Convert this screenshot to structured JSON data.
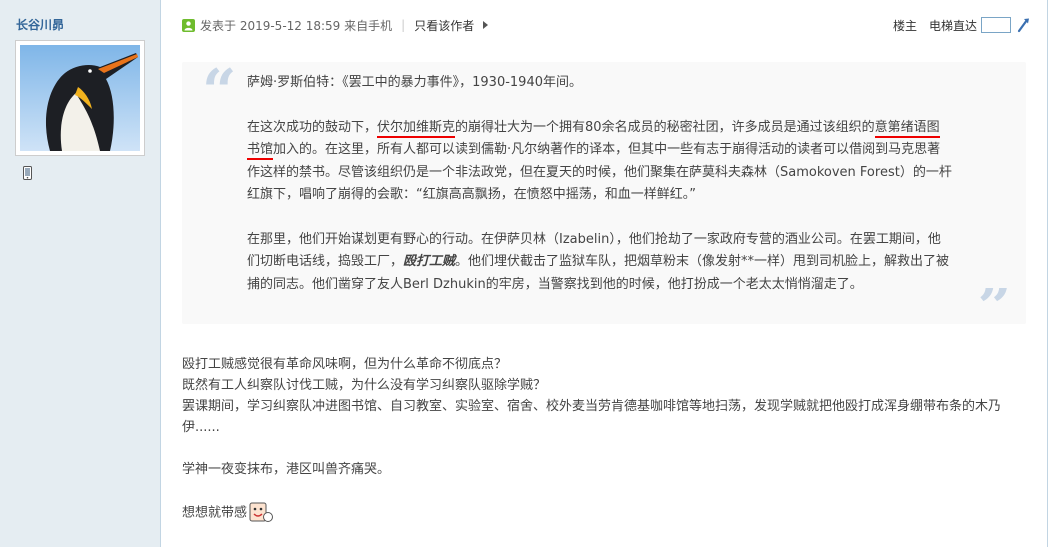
{
  "author": {
    "name": "长谷川昴",
    "avatar_icon": "penguin-avatar",
    "device_icon": "mobile-phone-icon"
  },
  "post_header": {
    "posted_at": "发表于 2019-5-12 18:59 来自手机",
    "separator": "|",
    "author_only": "只看该作者",
    "floor": "楼主",
    "jump_label": "电梯直达",
    "jump_value": ""
  },
  "quote": {
    "p1": "萨姆·罗斯伯特：《罢工中的暴力事件》，1930-1940年间。",
    "p2_a": "在这次成功的鼓动下，",
    "p2_b": "伏尔加维斯克",
    "p2_c": "的崩得壮大为一个拥有80余名成员的秘密社团，许多成员是通过该组织的",
    "p2_d": "意第绪语图书馆",
    "p2_e": "加入的。在这里，所有人都可以读到儒勒·凡尔纳著作的译本，但其中一些有志于崩得活动的读者可以借阅到马克思著作这样的禁书。尽管该组织仍是一个非法政党，但在夏天的时候，他们聚集在萨莫科夫森林（Samokoven Forest）的一杆红旗下，唱响了崩得的会歌：“红旗高高飘扬，在愤怒中摇荡，和血一样鲜红。”",
    "p3_a": "在那里，他们开始谋划更有野心的行动。在伊萨贝林（Izabelin），他们抢劫了一家政府专营的酒业公司。在罢工期间，他们切断电话线，捣毁工厂，",
    "p3_b": "殴打工贼",
    "p3_c": "。他们埋伏截击了监狱车队，把烟草粉末（像发射**一样）甩到司机脸上，解救出了被捕的同志。他们凿穿了友人Berl Dzhukin的牢房，当警察找到他的时候，他打扮成一个老太太悄悄溜走了。",
    "underline_color": "#e00000"
  },
  "body": {
    "line1": "殴打工贼感觉很有革命风味啊，但为什么革命不彻底点？",
    "line2": "既然有工人纠察队讨伐工贼，为什么没有学习纠察队驱除学贼？",
    "line3": "罢课期间，学习纠察队冲进图书馆、自习教室、实验室、宿舍、校外麦当劳肯德基咖啡馆等地扫荡，发现学贼就把他殴打成浑身绷带布条的木乃伊......",
    "line4": "学神一夜变抹布，港区叫兽齐痛哭。",
    "line5": "想想就带感",
    "emoji_icon": "grinning-face-emoji"
  },
  "colors": {
    "sidebar_bg": "#e5edf2",
    "author_link": "#336699",
    "quote_bg": "#f9f9f9",
    "online": "#6fbc2e"
  }
}
